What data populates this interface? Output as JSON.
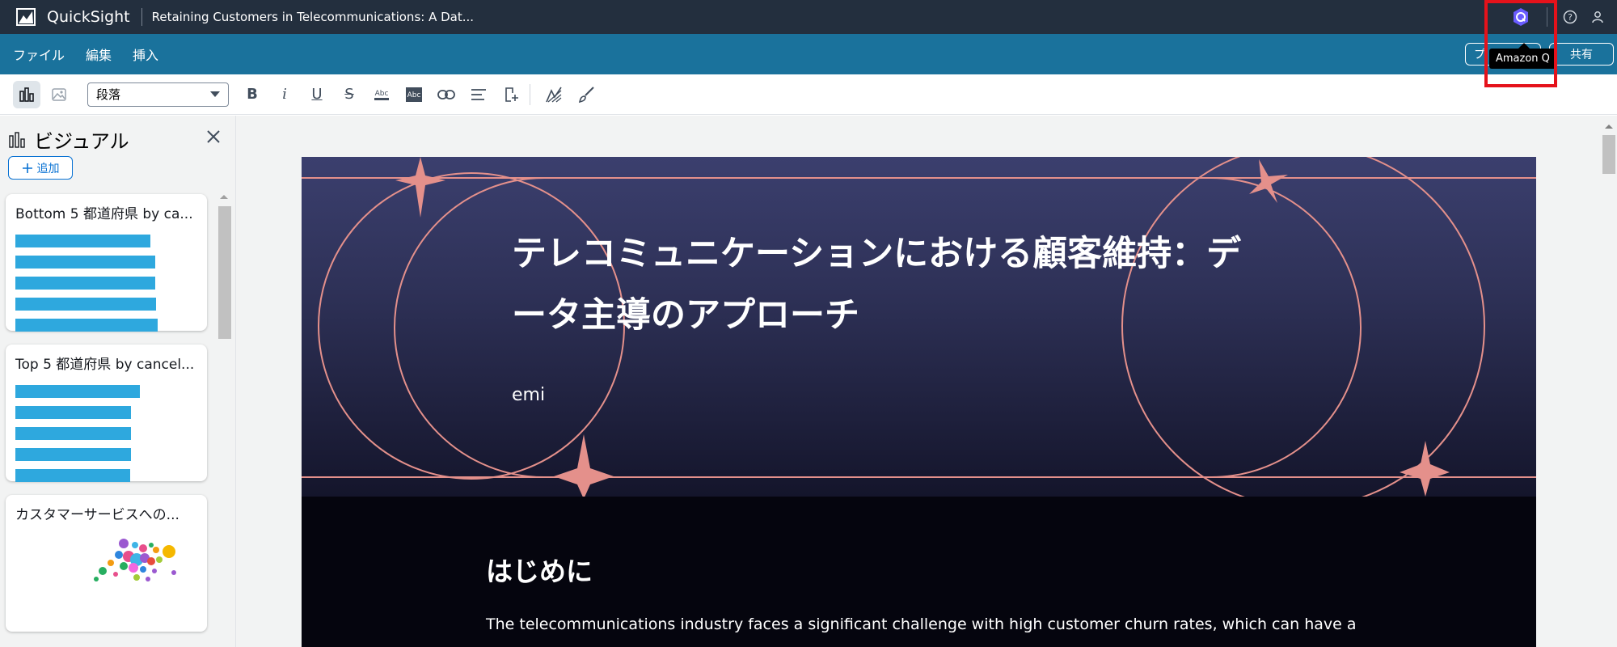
{
  "topbar": {
    "brand": "QuickSight",
    "doc_title": "Retaining Customers in Telecommunications: A Dat...",
    "tooltip": "Amazon Q"
  },
  "menubar": {
    "items": [
      "ファイル",
      "編集",
      "挿入"
    ],
    "preview_label": "プ",
    "share_label": "共有"
  },
  "toolbar": {
    "paragraph_select": "段落"
  },
  "sidebar": {
    "title": "ビジュアル",
    "add_label": "追加",
    "cards": [
      {
        "title": "Bottom 5 都道府県 by ca...",
        "bar_values": [
          0.97,
          1.0,
          1.0,
          1.0,
          1.02
        ]
      },
      {
        "title": "Top 5 都道府県 by cancel...",
        "bar_values": [
          1.0,
          0.93,
          0.93,
          0.93,
          0.93
        ]
      },
      {
        "title": "カスタマーサービスへの..."
      }
    ]
  },
  "story": {
    "title_line1": "テレコミュニケーションにおける顧客維持：デ",
    "title_line2": "ータ主導のアプローチ",
    "author": "emi",
    "section_heading": "はじめに",
    "section_text": "The telecommunications industry faces a significant challenge with high customer churn rates, which can have a"
  },
  "colors": {
    "topbar": "#232f3e",
    "menubar": "#1a729c",
    "accent": "#e5121b",
    "hero_ring": "#e4908b"
  }
}
